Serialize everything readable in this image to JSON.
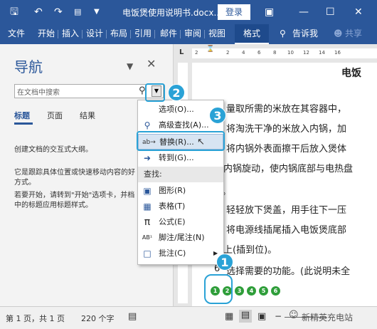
{
  "titlebar": {
    "save_icon": "save-icon",
    "undo_icon": "undo-icon",
    "redo_icon": "redo-icon",
    "doc_title": "电饭煲使用说明书.docx...",
    "login_label": "登录"
  },
  "ribbon": {
    "tabs": [
      "文件",
      "开始",
      "插入",
      "设计",
      "布局",
      "引用",
      "邮件",
      "审阅",
      "视图",
      "格式"
    ],
    "tell_me": "告诉我",
    "share": "共享"
  },
  "nav": {
    "title": "导航",
    "search_placeholder": "在文档中搜索",
    "tabs": [
      "标题",
      "页面",
      "结果"
    ],
    "text1": "创建文档的交互式大纲。",
    "text2": "它是跟踪具体位置或快速移动内容的好方式。",
    "text3": "若要开始，请转到\"开始\"选项卡，并档中的标题应用标题样式。"
  },
  "menu": {
    "options": "选项(O)...",
    "advanced_find": "高级查找(A)...",
    "replace": "替换(R)...",
    "goto": "转到(G)...",
    "heading": "查找:",
    "graphics": "图形(R)",
    "tables": "表格(T)",
    "equations": "公式(E)",
    "footnotes": "脚注/尾注(N)",
    "comments": "批注(C)"
  },
  "ruler": {
    "numbers": [
      "2",
      "2",
      "4",
      "6",
      "8",
      "10",
      "12",
      "14",
      "16"
    ]
  },
  "document": {
    "heading": "电饭",
    "lines": [
      "量取所需的米放在其容器中，",
      "将淘洗干净的米放入内锅，加",
      "将内锅外表面擦干后放入煲体",
      "内锅旋动，使内锅底部与电热盘",
      "。",
      "轻轻放下煲盖，用手往下一压",
      "将电源线插尾插入电饭煲底部",
      "上(插到位)。",
      "选择需要的功能。(此说明未全"
    ],
    "line9_prefix": "6"
  },
  "steps": [
    "1",
    "2",
    "3",
    "4",
    "5",
    "6"
  ],
  "callouts": [
    "1",
    "2",
    "3"
  ],
  "status": {
    "page": "第 1 页，共 1 页",
    "words": "220 个字",
    "watermark": "新精英充电站"
  }
}
